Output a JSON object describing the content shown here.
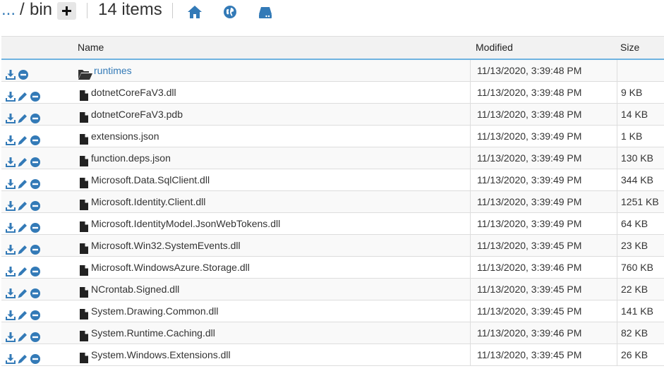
{
  "breadcrumb": {
    "ellipsis": "...",
    "separator": "/",
    "current": "bin"
  },
  "item_count": "14 items",
  "colors": {
    "link": "#337ab7",
    "header_border": "#6fb3e0",
    "icon": "#337ab7"
  },
  "table": {
    "headers": {
      "name": "Name",
      "modified": "Modified",
      "size": "Size"
    },
    "rows": [
      {
        "name": "runtimes",
        "type": "folder",
        "modified": "11/13/2020, 3:39:48 PM",
        "size": ""
      },
      {
        "name": "dotnetCoreFaV3.dll",
        "type": "file",
        "modified": "11/13/2020, 3:39:48 PM",
        "size": "9 KB"
      },
      {
        "name": "dotnetCoreFaV3.pdb",
        "type": "file",
        "modified": "11/13/2020, 3:39:48 PM",
        "size": "14 KB"
      },
      {
        "name": "extensions.json",
        "type": "file",
        "modified": "11/13/2020, 3:39:49 PM",
        "size": "1 KB"
      },
      {
        "name": "function.deps.json",
        "type": "file",
        "modified": "11/13/2020, 3:39:49 PM",
        "size": "130 KB"
      },
      {
        "name": "Microsoft.Data.SqlClient.dll",
        "type": "file",
        "modified": "11/13/2020, 3:39:49 PM",
        "size": "344 KB"
      },
      {
        "name": "Microsoft.Identity.Client.dll",
        "type": "file",
        "modified": "11/13/2020, 3:39:49 PM",
        "size": "1251 KB"
      },
      {
        "name": "Microsoft.IdentityModel.JsonWebTokens.dll",
        "type": "file",
        "modified": "11/13/2020, 3:39:49 PM",
        "size": "64 KB"
      },
      {
        "name": "Microsoft.Win32.SystemEvents.dll",
        "type": "file",
        "modified": "11/13/2020, 3:39:45 PM",
        "size": "23 KB"
      },
      {
        "name": "Microsoft.WindowsAzure.Storage.dll",
        "type": "file",
        "modified": "11/13/2020, 3:39:46 PM",
        "size": "760 KB"
      },
      {
        "name": "NCrontab.Signed.dll",
        "type": "file",
        "modified": "11/13/2020, 3:39:45 PM",
        "size": "22 KB"
      },
      {
        "name": "System.Drawing.Common.dll",
        "type": "file",
        "modified": "11/13/2020, 3:39:45 PM",
        "size": "141 KB"
      },
      {
        "name": "System.Runtime.Caching.dll",
        "type": "file",
        "modified": "11/13/2020, 3:39:46 PM",
        "size": "82 KB"
      },
      {
        "name": "System.Windows.Extensions.dll",
        "type": "file",
        "modified": "11/13/2020, 3:39:45 PM",
        "size": "26 KB"
      }
    ]
  }
}
